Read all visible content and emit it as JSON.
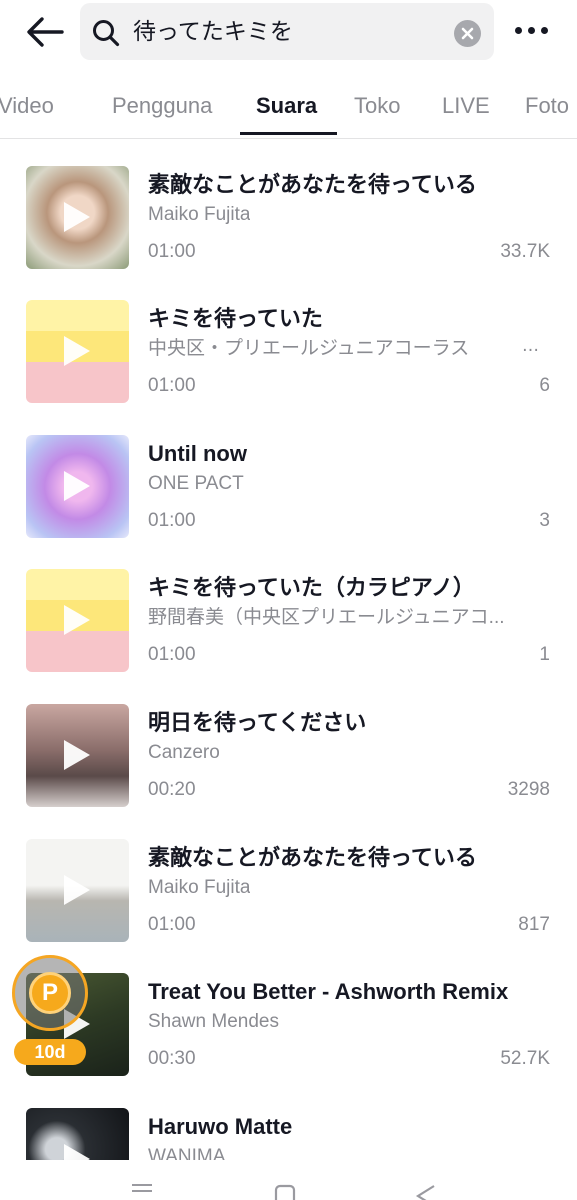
{
  "search": {
    "query": "待ってたキミを"
  },
  "tabs": [
    {
      "label": "Video"
    },
    {
      "label": "Pengguna"
    },
    {
      "label": "Suara"
    },
    {
      "label": "Toko"
    },
    {
      "label": "LIVE"
    },
    {
      "label": "Foto"
    }
  ],
  "active_tab": "Suara",
  "results": [
    {
      "title": "素敵なことがあなたを待っている",
      "artist": "Maiko Fujita",
      "duration": "01:00",
      "count": "33.7K"
    },
    {
      "title": "キミを待っていた",
      "artist": "中央区・プリエールジュニアコーラス",
      "artist_more": "…",
      "duration": "01:00",
      "count": "6"
    },
    {
      "title": "Until now",
      "artist": "ONE PACT",
      "duration": "01:00",
      "count": "3"
    },
    {
      "title": "キミを待っていた（カラピアノ）",
      "artist": "野間春美（中央区プリエールジュニアコ...",
      "duration": "01:00",
      "count": "1"
    },
    {
      "title": "明日を待ってください",
      "artist": "Canzero",
      "duration": "00:20",
      "count": "3298"
    },
    {
      "title": "素敵なことがあなたを待っている",
      "artist": "Maiko Fujita",
      "duration": "01:00",
      "count": "817"
    },
    {
      "title": "Treat You Better - Ashworth Remix",
      "artist": "Shawn Mendes",
      "duration": "00:30",
      "count": "52.7K"
    },
    {
      "title": "Haruwo Matte",
      "artist": "WANIMA",
      "duration": "",
      "count": ""
    }
  ],
  "points_badge": {
    "coin": "P",
    "label": "10d"
  },
  "icons": {
    "back": "arrow-left-icon",
    "search": "search-icon",
    "clear": "clear-icon",
    "more": "more-horizontal-icon",
    "play": "play-icon"
  },
  "colors": {
    "accent": "#161823",
    "muted": "#8a8b91",
    "badge": "#f6a91c"
  }
}
